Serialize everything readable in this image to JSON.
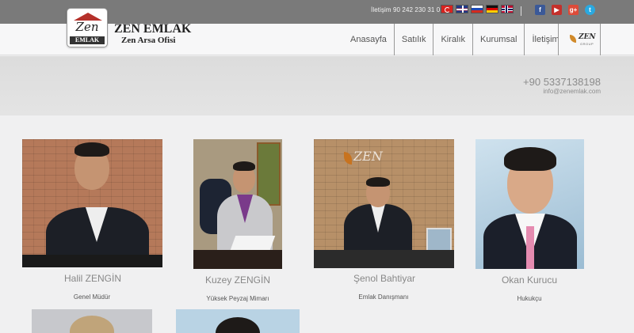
{
  "topbar": {
    "contact_label": "İletişim 90 242 230 31 01",
    "flags": [
      "turkish-flag",
      "uk-flag",
      "russian-flag",
      "german-flag",
      "norwegian-flag"
    ],
    "socials": [
      {
        "name": "facebook-icon",
        "glyph": "f"
      },
      {
        "name": "youtube-icon",
        "glyph": "▶"
      },
      {
        "name": "google-plus-icon",
        "glyph": "g+"
      },
      {
        "name": "twitter-icon",
        "glyph": "t"
      }
    ]
  },
  "brand": {
    "logo_text": "Zen",
    "logo_sub": "EMLAK",
    "title": "ZEN EMLAK",
    "subtitle": "Zen Arsa Ofisi"
  },
  "nav": {
    "items": [
      "Anasayfa",
      "Satılık",
      "Kiralık",
      "Kurumsal",
      "İletişim"
    ],
    "group_logo_text": "ZEN",
    "group_logo_sub": "GROUP"
  },
  "banner": {
    "phone": "+90 5337138198",
    "email": "info@zenemlak.com"
  },
  "team": [
    {
      "name": "Halil ZENGİN",
      "role": "Genel Müdür"
    },
    {
      "name": "Kuzey ZENGİN",
      "role": "Yüksek Peyzaj Mimarı"
    },
    {
      "name": "Şenol Bahtiyar",
      "role": "Emlak Danışmanı"
    },
    {
      "name": "Okan Kurucu",
      "role": "Hukukçu"
    }
  ],
  "colors": {
    "topbar": "#7a7a7a",
    "banner": "#dcdcdc",
    "page": "#f0f0f1"
  }
}
